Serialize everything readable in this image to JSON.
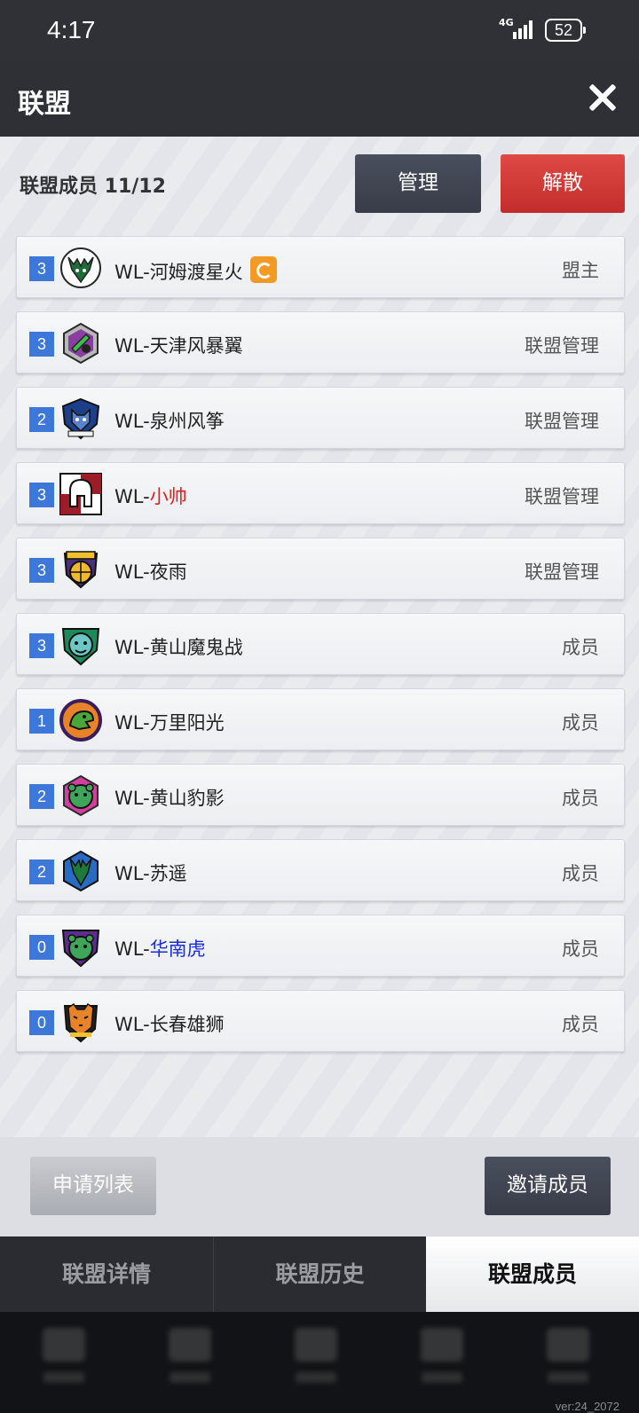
{
  "status_bar": {
    "time": "4:17",
    "network": "4G",
    "battery": "52"
  },
  "header": {
    "title": "联盟"
  },
  "panel": {
    "members_label": "联盟成员 11/12",
    "manage_label": "管理",
    "disband_label": "解散"
  },
  "members": [
    {
      "level": "3",
      "prefix": "WL-",
      "name": "河姆渡星火",
      "name_color": "default",
      "role": "盟主",
      "logo": "bucks-deer-icon",
      "badge": true
    },
    {
      "level": "3",
      "prefix": "WL-",
      "name": "天津风暴翼",
      "name_color": "default",
      "role": "联盟管理",
      "logo": "rocket-hexagon-icon"
    },
    {
      "level": "2",
      "prefix": "WL-",
      "name": "泉州风筝",
      "name_color": "default",
      "role": "联盟管理",
      "logo": "wolf-shield-icon"
    },
    {
      "level": "3",
      "prefix": "WL-",
      "name": "小帅",
      "name_color": "red",
      "role": "联盟管理",
      "logo": "spartan-helmet-icon"
    },
    {
      "level": "3",
      "prefix": "WL-",
      "name": "夜雨",
      "name_color": "default",
      "role": "联盟管理",
      "logo": "basketball-crest-icon"
    },
    {
      "level": "3",
      "prefix": "WL-",
      "name": "黄山魔鬼战",
      "name_color": "default",
      "role": "成员",
      "logo": "bear-shield-icon"
    },
    {
      "level": "1",
      "prefix": "WL-",
      "name": "万里阳光",
      "name_color": "default",
      "role": "成员",
      "logo": "dinosaur-circle-icon"
    },
    {
      "level": "2",
      "prefix": "WL-",
      "name": "黄山豹影",
      "name_color": "default",
      "role": "成员",
      "logo": "bear-hexagon-icon"
    },
    {
      "level": "2",
      "prefix": "WL-",
      "name": "苏遥",
      "name_color": "default",
      "role": "成员",
      "logo": "deer-shield-icon"
    },
    {
      "level": "0",
      "prefix": "WL-",
      "name": "华南虎",
      "name_color": "blue",
      "role": "成员",
      "logo": "bear-purple-shield-icon"
    },
    {
      "level": "0",
      "prefix": "WL-",
      "name": "长春雄狮",
      "name_color": "default",
      "role": "成员",
      "logo": "tiger-crest-icon"
    }
  ],
  "bottom_actions": {
    "apply_list_label": "申请列表",
    "invite_label": "邀请成员"
  },
  "tabs": [
    {
      "label": "联盟详情",
      "active": false
    },
    {
      "label": "联盟历史",
      "active": false
    },
    {
      "label": "联盟成员",
      "active": true
    }
  ],
  "version": "ver:24_2072",
  "colors": {
    "accent_blue": "#3d78d8",
    "disband_red": "#d63a36",
    "dark_button": "#3f4350",
    "badge_orange": "#f29a24"
  }
}
